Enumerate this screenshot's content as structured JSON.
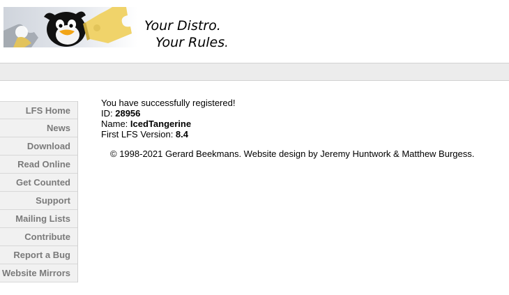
{
  "header": {
    "slogan_line1": "Your Distro.",
    "slogan_line2": "Your Rules."
  },
  "nav": {
    "items": [
      {
        "label": "LFS Home"
      },
      {
        "label": "News"
      },
      {
        "label": "Download"
      },
      {
        "label": "Read Online"
      },
      {
        "label": "Get Counted"
      },
      {
        "label": "Support"
      },
      {
        "label": "Mailing Lists"
      },
      {
        "label": "Contribute"
      },
      {
        "label": "Report a Bug"
      },
      {
        "label": "Website Mirrors"
      }
    ]
  },
  "registration": {
    "success_message": "You have successfully registered!",
    "id_label": "ID: ",
    "id_value": "28956",
    "name_label": "Name: ",
    "name_value": "IcedTangerine",
    "version_label": "First LFS Version: ",
    "version_value": "8.4"
  },
  "footer": {
    "copyright": "© 1998-2021 Gerard Beekmans. Website design by Jeremy Huntwork & Matthew Burgess."
  },
  "colors": {
    "nav_text": "#7a7a7a",
    "nav_bg": "#f1f1f1",
    "bar_bg": "#ececec",
    "puzzle_yellow": "#f0d36a"
  },
  "icons": [
    "tux-puzzle-logo"
  ]
}
